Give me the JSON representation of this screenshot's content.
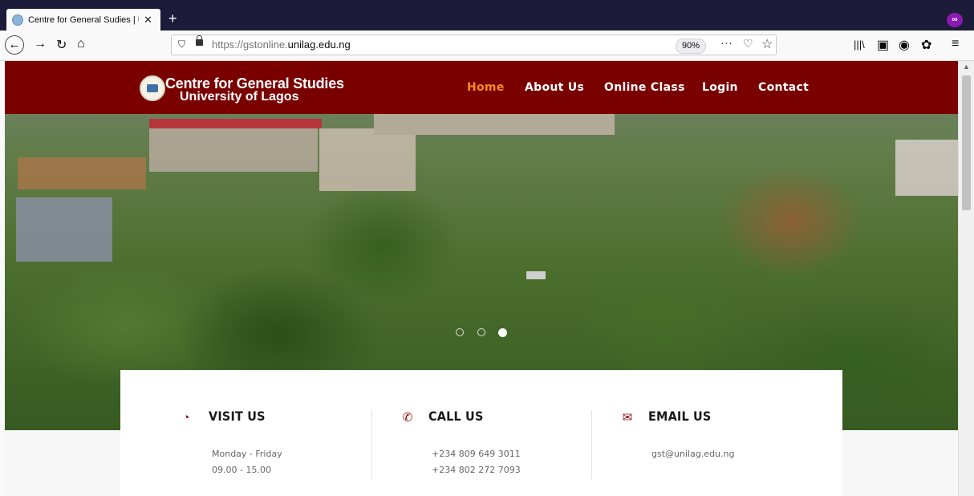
{
  "browser": {
    "tab_title": "Centre for General Sudies | UNI",
    "tab_close": "✕",
    "new_tab": "+",
    "url_prefix": "https://gstonline.",
    "url_domain": "unilag.edu.ng",
    "zoom": "90%",
    "icons": [
      "back-arrow-icon",
      "forward-arrow-icon",
      "reload-icon",
      "home-icon",
      "shield-icon",
      "lock-icon",
      "more-icon",
      "pocket-icon",
      "star-icon",
      "library-icon",
      "sidebar-icon",
      "account-icon",
      "extension-icon",
      "hamburger-menu-icon",
      "private-mask-icon"
    ]
  },
  "site": {
    "brand_line1": "Centre for General Studies",
    "brand_line2": "University of Lagos",
    "nav": [
      {
        "label": "Home",
        "active": true
      },
      {
        "label": "About Us",
        "active": false
      },
      {
        "label": "Online Class",
        "active": false
      },
      {
        "label": "Login",
        "active": false
      },
      {
        "label": "Contact",
        "active": false
      }
    ],
    "slider": {
      "count": 3,
      "active_index": 2
    },
    "annotation": {
      "type": "red-arrow",
      "points_to": "Online Class"
    },
    "info": [
      {
        "icon": "clock-icon",
        "title": "VISIT US",
        "lines": [
          "Monday - Friday",
          "09.00 - 15.00"
        ]
      },
      {
        "icon": "phone-icon",
        "title": "CALL US",
        "lines": [
          "+234 809 649 3011",
          "+234 802 272 7093"
        ]
      },
      {
        "icon": "envelope-icon",
        "title": "EMAIL US",
        "lines": [
          "gst@unilag.edu.ng"
        ]
      }
    ]
  },
  "colors": {
    "header": "#7a0000",
    "active_nav": "#f58b1f",
    "icon_accent": "#8c0a0a",
    "browser_tabbar": "#1c1b3a"
  }
}
